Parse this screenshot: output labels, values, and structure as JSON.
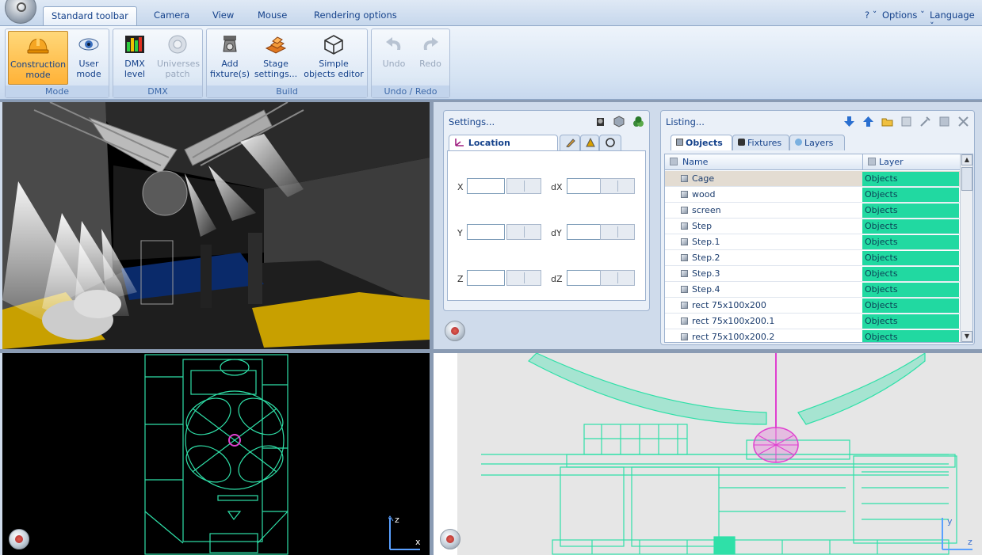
{
  "ribbon_tabs": [
    {
      "label": "Standard toolbar",
      "active": true
    },
    {
      "label": "Camera",
      "active": false
    },
    {
      "label": "View",
      "active": false
    },
    {
      "label": "Mouse",
      "active": false
    },
    {
      "label": "Rendering options",
      "active": false
    }
  ],
  "right_menu": {
    "help": "? ˇ",
    "options": "Options ˇ",
    "language": "Language ˇ"
  },
  "groups": {
    "mode": {
      "caption": "Mode",
      "construction": "Construction mode",
      "user": "User mode"
    },
    "dmx": {
      "caption": "DMX",
      "level": "DMX level",
      "patch": "Universes patch"
    },
    "build": {
      "caption": "Build",
      "add": "Add fixture(s)",
      "stage": "Stage settings...",
      "simple": "Simple objects editor"
    },
    "undo": {
      "caption": "Undo / Redo",
      "undo": "Undo",
      "redo": "Redo"
    }
  },
  "settings": {
    "title": "Settings...",
    "tab_location": "Location",
    "labels": {
      "x": "X",
      "y": "Y",
      "z": "Z",
      "dx": "dX",
      "dy": "dY",
      "dz": "dZ"
    }
  },
  "listing": {
    "title": "Listing...",
    "tabs": [
      "Objects",
      "Fixtures",
      "Layers"
    ],
    "columns": {
      "name": "Name",
      "layer": "Layer"
    },
    "rows": [
      {
        "name": "Cage",
        "layer": "Objects"
      },
      {
        "name": "wood",
        "layer": "Objects"
      },
      {
        "name": "screen",
        "layer": "Objects"
      },
      {
        "name": "Step",
        "layer": "Objects"
      },
      {
        "name": "Step.1",
        "layer": "Objects"
      },
      {
        "name": "Step.2",
        "layer": "Objects"
      },
      {
        "name": "Step.3",
        "layer": "Objects"
      },
      {
        "name": "Step.4",
        "layer": "Objects"
      },
      {
        "name": "rect 75x100x200",
        "layer": "Objects"
      },
      {
        "name": "rect 75x100x200.1",
        "layer": "Objects"
      },
      {
        "name": "rect 75x100x200.2",
        "layer": "Objects"
      }
    ],
    "selected_row": 0
  },
  "axes": {
    "top_view": {
      "v": "z",
      "h": "x"
    },
    "side_view": {
      "v": "y",
      "h": "z"
    }
  },
  "colors": {
    "wire": "#2fe0a8",
    "accent_magenta": "#e040d0",
    "layer_cell": "#21d9a1"
  }
}
